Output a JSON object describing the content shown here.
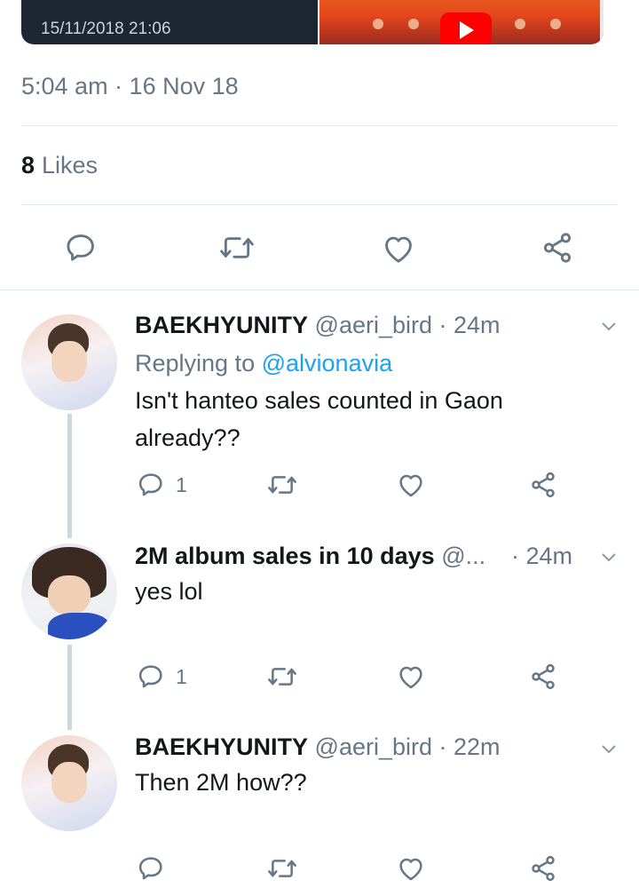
{
  "quoted": {
    "date": "15/11/2018 21:06"
  },
  "main_tweet": {
    "timestamp": "5:04 am · 16 Nov 18",
    "likes_count": "8",
    "likes_label": "Likes"
  },
  "replies": [
    {
      "name": "BAEKHYUNITY",
      "handle": "@aeri_bird",
      "time": "· 24m",
      "replying_label": "Replying to",
      "replying_to": "@alvionavia",
      "text": "Isn't hanteo sales counted in Gaon already??",
      "reply_count": "1"
    },
    {
      "name": "2M album sales in 10 days",
      "handle": "@...",
      "time": "· 24m",
      "text": "yes lol",
      "reply_count": "1"
    },
    {
      "name": "BAEKHYUNITY",
      "handle": "@aeri_bird",
      "time": "· 22m",
      "text": "Then 2M how??"
    }
  ],
  "icons": [
    "reply-icon",
    "retweet-icon",
    "like-icon",
    "share-icon",
    "chevron-down-icon"
  ],
  "colors": {
    "text": "#14171a",
    "secondary": "#657786",
    "link": "#1da1f2",
    "divider": "#e1e8ed"
  }
}
